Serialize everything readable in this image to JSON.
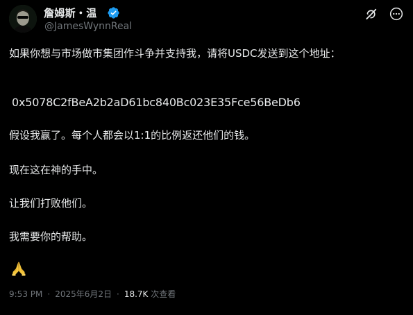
{
  "author": {
    "display_name": "詹姆斯・温",
    "handle": "@JamesWynnReal",
    "verified": true,
    "avatar_icon": "avatar-portrait-dark-sunglasses"
  },
  "actions": {
    "grok_icon": "grok-icon",
    "more_icon": "more-icon"
  },
  "post": {
    "line1": "如果你想与市场做市集团作斗争并支持我，请将USDC发送到这个地址：",
    "address": "0x5078C2fBeA2b2aD61bc840Bc023E35Fce56BeDb6",
    "line3": "假设我赢了。每个人都会以1:1的比例返还他们的钱。",
    "line4": "现在这在神的手中。",
    "line5": "让我们打败他们。",
    "line6": "我需要你的帮助。",
    "emoji": "🙏",
    "emoji_icon": "folded-hands-icon"
  },
  "meta": {
    "time": "9:53 PM",
    "separator": "·",
    "date": "2025年6月2日",
    "views_count": "18.7K",
    "views_label": "次查看"
  },
  "colors": {
    "background": "#000000",
    "text": "#e7e9ea",
    "secondary": "#71767b",
    "verified": "#1d9bf0"
  }
}
